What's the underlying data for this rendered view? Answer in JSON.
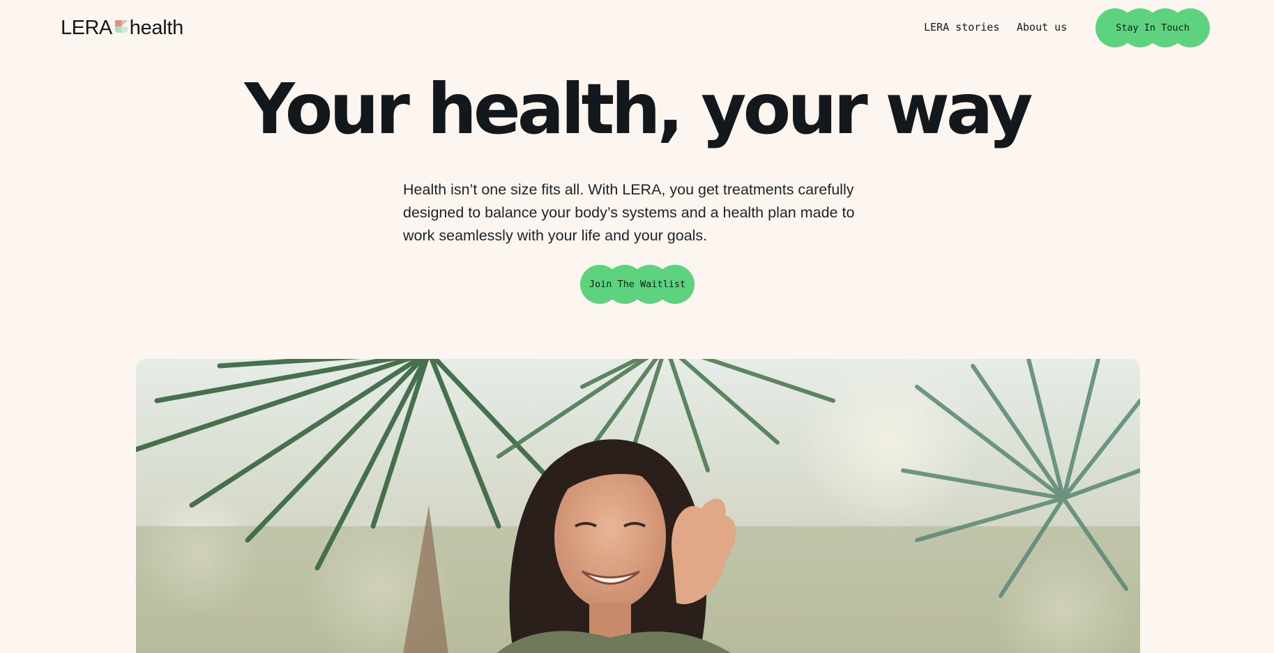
{
  "header": {
    "logo": {
      "text_left": "LERA",
      "text_right": "health"
    },
    "nav": {
      "stories_label": "LERA stories",
      "about_label": "About us"
    },
    "cta_label": "Stay In Touch"
  },
  "hero": {
    "title": "Your health, your way",
    "subtitle": "Health isn’t one size fits all. With LERA, you get treatments carefully designed to balance your body’s systems and a health plan made to work seamlessly with your life and your goals.",
    "cta_label": "Join The Waitlist"
  },
  "photo": {
    "subject": "smiling woman under palm leaves"
  },
  "colors": {
    "background": "#fdf5ef",
    "accent_green": "#5dd37f",
    "text": "#13181c",
    "logo_mark_coral": "#ee8a78",
    "logo_mark_mint": "#a9dfc7"
  },
  "icons": {
    "logo_mark": "lera-logo-mark-icon"
  }
}
